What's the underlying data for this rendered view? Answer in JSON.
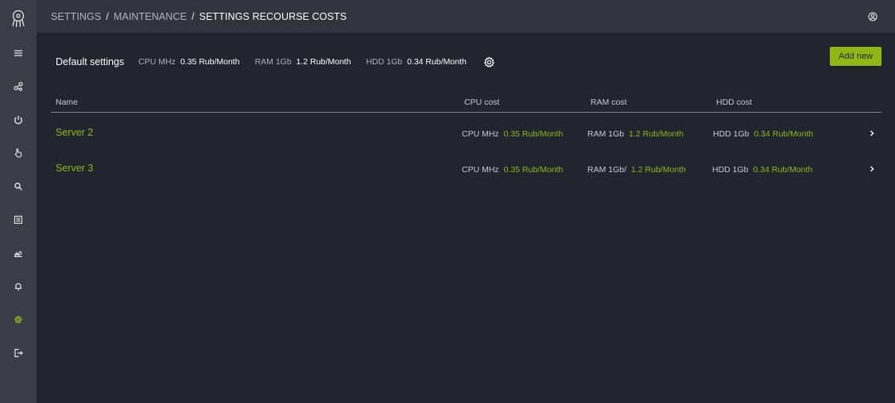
{
  "breadcrumb": {
    "items": [
      "SETTINGS",
      "MAINTENANCE"
    ],
    "separator": "/",
    "current": "SETTINGS RECOURSE COSTS"
  },
  "defaults": {
    "title": "Default settings",
    "cpu_label": "CPU MHz",
    "cpu_value": "0.35 Rub/Month",
    "ram_label": "RAM 1Gb",
    "ram_value": "1.2 Rub/Month",
    "hdd_label": "HDD 1Gb",
    "hdd_value": "0.34 Rub/Month"
  },
  "add_new_label": "Add new",
  "table": {
    "columns": [
      "Name",
      "CPU cost",
      "RAM cost",
      "HDD cost"
    ],
    "rows": [
      {
        "name": "Server 2",
        "cpu_label": "CPU MHz",
        "cpu_value": "0.35 Rub/Month",
        "ram_label": "RAM 1Gb",
        "ram_value": "1.2 Rub/Month",
        "hdd_label": "HDD 1Gb",
        "hdd_value": "0.34 Rub/Month"
      },
      {
        "name": "Server 3",
        "cpu_label": "CPU MHz",
        "cpu_value": "0.35 Rub/Month",
        "ram_label": "RAM 1Gb/",
        "ram_value": "1.2 Rub/Month",
        "hdd_label": "HDD 1Gb",
        "hdd_value": "0.34 Rub/Month"
      }
    ]
  },
  "sidebar_icons": [
    "layers-icon",
    "share-icon",
    "power-icon",
    "hand-pointer-icon",
    "search-icon",
    "list-icon",
    "chart-icon",
    "bell-icon",
    "settings-icon",
    "logout-icon"
  ],
  "colors": {
    "accent": "#8db816",
    "background": "#22252e",
    "sidebar": "#3a3d45",
    "topbar": "#31343c"
  }
}
